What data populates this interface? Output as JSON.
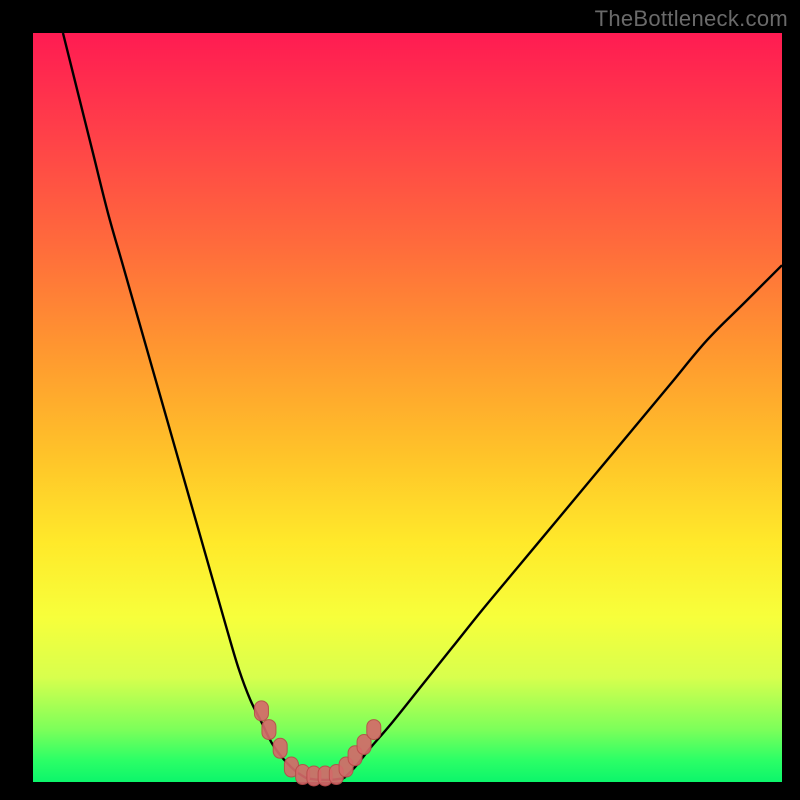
{
  "watermark": "TheBottleneck.com",
  "colors": {
    "background_black": "#000000",
    "gradient_top": "#ff1b52",
    "gradient_mid": "#ffe92a",
    "gradient_bottom": "#0cf56b",
    "curve_stroke": "#000000",
    "marker_fill": "#d46a6a",
    "marker_stroke": "#b94a4a"
  },
  "chart_data": {
    "type": "line",
    "title": "",
    "xlabel": "",
    "ylabel": "",
    "xlim": [
      0,
      100
    ],
    "ylim": [
      0,
      100
    ],
    "grid": false,
    "legend": null,
    "note": "Axes unlabeled; values are normalized 0–100 estimated from pixel positions. y=0 is bottom (green), y=100 is top (red). Two black curves form a V shape, flat segment at bottom (minimum). Pink rounded markers cluster near the bottom of the V.",
    "series": [
      {
        "name": "left_curve",
        "x": [
          4,
          6,
          8,
          10,
          12,
          14,
          16,
          18,
          20,
          22,
          24,
          26,
          27.5,
          29,
          30.5,
          32,
          33.5,
          35,
          36.5
        ],
        "y": [
          100,
          92,
          84,
          76,
          69,
          62,
          55,
          48,
          41,
          34,
          27,
          20,
          15,
          11,
          8,
          5,
          3,
          1.5,
          0.5
        ]
      },
      {
        "name": "valley_flat",
        "x": [
          36.5,
          38,
          40,
          41.5
        ],
        "y": [
          0.5,
          0.3,
          0.3,
          0.5
        ]
      },
      {
        "name": "right_curve",
        "x": [
          41.5,
          43,
          45,
          48,
          52,
          56,
          60,
          65,
          70,
          75,
          80,
          85,
          90,
          95,
          100
        ],
        "y": [
          0.5,
          2,
          4.5,
          8,
          13,
          18,
          23,
          29,
          35,
          41,
          47,
          53,
          59,
          64,
          69
        ]
      }
    ],
    "markers": {
      "name": "highlighted_points",
      "shape": "rounded",
      "x": [
        30.5,
        31.5,
        33.0,
        34.5,
        36.0,
        37.5,
        39.0,
        40.5,
        41.8,
        43.0,
        44.2,
        45.5
      ],
      "y": [
        9.5,
        7.0,
        4.5,
        2.0,
        1.0,
        0.8,
        0.8,
        1.0,
        2.0,
        3.5,
        5.0,
        7.0
      ]
    }
  }
}
